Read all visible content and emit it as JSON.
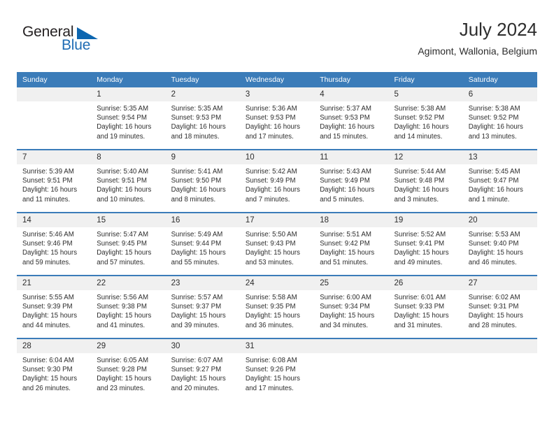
{
  "logo": {
    "word_top": "General",
    "word_bottom": "Blue",
    "triangle_icon": "triangle-icon",
    "accent_color": "#0d66b0"
  },
  "header": {
    "month_title": "July 2024",
    "location": "Agimont, Wallonia, Belgium"
  },
  "calendar": {
    "header_bg": "#3b7cb9",
    "daynum_bg": "#f0f0f0",
    "weekday_headers": [
      "Sunday",
      "Monday",
      "Tuesday",
      "Wednesday",
      "Thursday",
      "Friday",
      "Saturday"
    ],
    "weeks": [
      [
        {
          "day": "",
          "blank": true,
          "sunrise": "",
          "sunset": "",
          "daylight1": "",
          "daylight2": ""
        },
        {
          "day": "1",
          "sunrise": "Sunrise: 5:35 AM",
          "sunset": "Sunset: 9:54 PM",
          "daylight1": "Daylight: 16 hours",
          "daylight2": "and 19 minutes."
        },
        {
          "day": "2",
          "sunrise": "Sunrise: 5:35 AM",
          "sunset": "Sunset: 9:53 PM",
          "daylight1": "Daylight: 16 hours",
          "daylight2": "and 18 minutes."
        },
        {
          "day": "3",
          "sunrise": "Sunrise: 5:36 AM",
          "sunset": "Sunset: 9:53 PM",
          "daylight1": "Daylight: 16 hours",
          "daylight2": "and 17 minutes."
        },
        {
          "day": "4",
          "sunrise": "Sunrise: 5:37 AM",
          "sunset": "Sunset: 9:53 PM",
          "daylight1": "Daylight: 16 hours",
          "daylight2": "and 15 minutes."
        },
        {
          "day": "5",
          "sunrise": "Sunrise: 5:38 AM",
          "sunset": "Sunset: 9:52 PM",
          "daylight1": "Daylight: 16 hours",
          "daylight2": "and 14 minutes."
        },
        {
          "day": "6",
          "sunrise": "Sunrise: 5:38 AM",
          "sunset": "Sunset: 9:52 PM",
          "daylight1": "Daylight: 16 hours",
          "daylight2": "and 13 minutes."
        }
      ],
      [
        {
          "day": "7",
          "sunrise": "Sunrise: 5:39 AM",
          "sunset": "Sunset: 9:51 PM",
          "daylight1": "Daylight: 16 hours",
          "daylight2": "and 11 minutes."
        },
        {
          "day": "8",
          "sunrise": "Sunrise: 5:40 AM",
          "sunset": "Sunset: 9:51 PM",
          "daylight1": "Daylight: 16 hours",
          "daylight2": "and 10 minutes."
        },
        {
          "day": "9",
          "sunrise": "Sunrise: 5:41 AM",
          "sunset": "Sunset: 9:50 PM",
          "daylight1": "Daylight: 16 hours",
          "daylight2": "and 8 minutes."
        },
        {
          "day": "10",
          "sunrise": "Sunrise: 5:42 AM",
          "sunset": "Sunset: 9:49 PM",
          "daylight1": "Daylight: 16 hours",
          "daylight2": "and 7 minutes."
        },
        {
          "day": "11",
          "sunrise": "Sunrise: 5:43 AM",
          "sunset": "Sunset: 9:49 PM",
          "daylight1": "Daylight: 16 hours",
          "daylight2": "and 5 minutes."
        },
        {
          "day": "12",
          "sunrise": "Sunrise: 5:44 AM",
          "sunset": "Sunset: 9:48 PM",
          "daylight1": "Daylight: 16 hours",
          "daylight2": "and 3 minutes."
        },
        {
          "day": "13",
          "sunrise": "Sunrise: 5:45 AM",
          "sunset": "Sunset: 9:47 PM",
          "daylight1": "Daylight: 16 hours",
          "daylight2": "and 1 minute."
        }
      ],
      [
        {
          "day": "14",
          "sunrise": "Sunrise: 5:46 AM",
          "sunset": "Sunset: 9:46 PM",
          "daylight1": "Daylight: 15 hours",
          "daylight2": "and 59 minutes."
        },
        {
          "day": "15",
          "sunrise": "Sunrise: 5:47 AM",
          "sunset": "Sunset: 9:45 PM",
          "daylight1": "Daylight: 15 hours",
          "daylight2": "and 57 minutes."
        },
        {
          "day": "16",
          "sunrise": "Sunrise: 5:49 AM",
          "sunset": "Sunset: 9:44 PM",
          "daylight1": "Daylight: 15 hours",
          "daylight2": "and 55 minutes."
        },
        {
          "day": "17",
          "sunrise": "Sunrise: 5:50 AM",
          "sunset": "Sunset: 9:43 PM",
          "daylight1": "Daylight: 15 hours",
          "daylight2": "and 53 minutes."
        },
        {
          "day": "18",
          "sunrise": "Sunrise: 5:51 AM",
          "sunset": "Sunset: 9:42 PM",
          "daylight1": "Daylight: 15 hours",
          "daylight2": "and 51 minutes."
        },
        {
          "day": "19",
          "sunrise": "Sunrise: 5:52 AM",
          "sunset": "Sunset: 9:41 PM",
          "daylight1": "Daylight: 15 hours",
          "daylight2": "and 49 minutes."
        },
        {
          "day": "20",
          "sunrise": "Sunrise: 5:53 AM",
          "sunset": "Sunset: 9:40 PM",
          "daylight1": "Daylight: 15 hours",
          "daylight2": "and 46 minutes."
        }
      ],
      [
        {
          "day": "21",
          "sunrise": "Sunrise: 5:55 AM",
          "sunset": "Sunset: 9:39 PM",
          "daylight1": "Daylight: 15 hours",
          "daylight2": "and 44 minutes."
        },
        {
          "day": "22",
          "sunrise": "Sunrise: 5:56 AM",
          "sunset": "Sunset: 9:38 PM",
          "daylight1": "Daylight: 15 hours",
          "daylight2": "and 41 minutes."
        },
        {
          "day": "23",
          "sunrise": "Sunrise: 5:57 AM",
          "sunset": "Sunset: 9:37 PM",
          "daylight1": "Daylight: 15 hours",
          "daylight2": "and 39 minutes."
        },
        {
          "day": "24",
          "sunrise": "Sunrise: 5:58 AM",
          "sunset": "Sunset: 9:35 PM",
          "daylight1": "Daylight: 15 hours",
          "daylight2": "and 36 minutes."
        },
        {
          "day": "25",
          "sunrise": "Sunrise: 6:00 AM",
          "sunset": "Sunset: 9:34 PM",
          "daylight1": "Daylight: 15 hours",
          "daylight2": "and 34 minutes."
        },
        {
          "day": "26",
          "sunrise": "Sunrise: 6:01 AM",
          "sunset": "Sunset: 9:33 PM",
          "daylight1": "Daylight: 15 hours",
          "daylight2": "and 31 minutes."
        },
        {
          "day": "27",
          "sunrise": "Sunrise: 6:02 AM",
          "sunset": "Sunset: 9:31 PM",
          "daylight1": "Daylight: 15 hours",
          "daylight2": "and 28 minutes."
        }
      ],
      [
        {
          "day": "28",
          "sunrise": "Sunrise: 6:04 AM",
          "sunset": "Sunset: 9:30 PM",
          "daylight1": "Daylight: 15 hours",
          "daylight2": "and 26 minutes."
        },
        {
          "day": "29",
          "sunrise": "Sunrise: 6:05 AM",
          "sunset": "Sunset: 9:28 PM",
          "daylight1": "Daylight: 15 hours",
          "daylight2": "and 23 minutes."
        },
        {
          "day": "30",
          "sunrise": "Sunrise: 6:07 AM",
          "sunset": "Sunset: 9:27 PM",
          "daylight1": "Daylight: 15 hours",
          "daylight2": "and 20 minutes."
        },
        {
          "day": "31",
          "sunrise": "Sunrise: 6:08 AM",
          "sunset": "Sunset: 9:26 PM",
          "daylight1": "Daylight: 15 hours",
          "daylight2": "and 17 minutes."
        },
        {
          "day": "",
          "blank": true,
          "sunrise": "",
          "sunset": "",
          "daylight1": "",
          "daylight2": ""
        },
        {
          "day": "",
          "blank": true,
          "sunrise": "",
          "sunset": "",
          "daylight1": "",
          "daylight2": ""
        },
        {
          "day": "",
          "blank": true,
          "sunrise": "",
          "sunset": "",
          "daylight1": "",
          "daylight2": ""
        }
      ]
    ]
  }
}
